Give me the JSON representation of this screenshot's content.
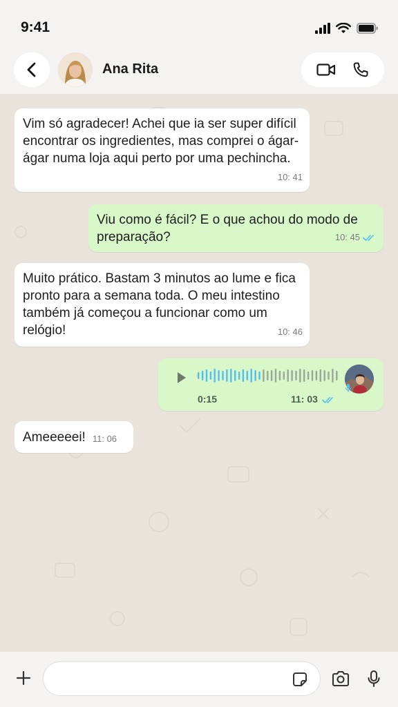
{
  "status_bar": {
    "time": "9:41"
  },
  "header": {
    "contact_name": "Ana Rita"
  },
  "messages": [
    {
      "direction": "in",
      "text": "Vim só agradecer! Achei que ia ser super difícil encontrar os ingredientes, mas comprei o ágar-ágar numa loja aqui perto por uma pechincha.",
      "time": "10: 41"
    },
    {
      "direction": "out",
      "text": "Viu como é fácil? E o que achou do modo de preparação?",
      "time": "10: 45",
      "status": "read"
    },
    {
      "direction": "in",
      "text": "Muito prático. Bastam 3 minutos ao lume e fica pronto para a semana toda. O meu intestino também já começou a funcionar como um relógio!",
      "time": "10: 46"
    },
    {
      "direction": "out",
      "type": "voice",
      "duration": "0:15",
      "time": "11: 03",
      "status": "read",
      "progress": 0.45
    },
    {
      "direction": "in",
      "text": "Ameeeeei!",
      "time": "11: 06"
    }
  ],
  "input": {
    "placeholder": "",
    "value": ""
  },
  "colors": {
    "incoming": "#ffffff",
    "outgoing": "#d8f8c9",
    "read_tick": "#53bdeb",
    "background": "#e9e3db",
    "bar": "#f4f3f1"
  },
  "icons": [
    "back-arrow-icon",
    "video-call-icon",
    "phone-icon",
    "plus-icon",
    "sticker-icon",
    "camera-icon",
    "microphone-icon",
    "play-icon",
    "double-check-icon"
  ]
}
